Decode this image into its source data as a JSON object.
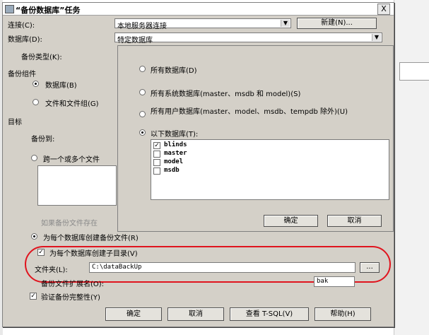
{
  "window": {
    "title": "“备份数据库”任务",
    "close": "X"
  },
  "connection": {
    "label": "连接(C):",
    "value": "本地服务器连接",
    "new_button": "新建(N)..."
  },
  "database": {
    "label": "数据库(D):",
    "value": "特定数据库"
  },
  "backup_type": {
    "label": "备份类型(K):"
  },
  "backup_component": {
    "label": "备份组件",
    "database_option": "数据库(B)",
    "files_option": "文件和文件组(G)"
  },
  "target": {
    "label": "目标",
    "backup_to": "备份到:",
    "span_option": "跨一个或多个文件",
    "if_exists": "如果备份文件存在"
  },
  "popup": {
    "options": [
      "所有数据库(D)",
      "所有系统数据库(master、msdb 和 model)(S)",
      "所有用户数据库(master、model、msdb、tempdb 除外)(U)",
      "以下数据库(T):"
    ],
    "databases": [
      {
        "name": "blinds",
        "checked": true
      },
      {
        "name": "master",
        "checked": false
      },
      {
        "name": "model",
        "checked": false
      },
      {
        "name": "msdb",
        "checked": false
      }
    ],
    "ok": "确定",
    "cancel": "取消"
  },
  "per_db_file": {
    "label": "为每个数据库创建备份文件(R)"
  },
  "subdir": {
    "label": "为每个数据库创建子目录(V)"
  },
  "folder": {
    "label": "文件夹(L):",
    "value": "C:\\dataBackUp",
    "browse": "..."
  },
  "extension": {
    "label": "备份文件扩展名(O):",
    "value": "bak"
  },
  "verify": {
    "label": "验证备份完整性(Y)"
  },
  "buttons": {
    "ok": "确定",
    "cancel": "取消",
    "view_tsql": "查看 T-SQL(V)",
    "help": "帮助(H)"
  },
  "colors": {
    "dialog_bg": "#d4d0c8",
    "highlight_oval": "#e0141e"
  }
}
